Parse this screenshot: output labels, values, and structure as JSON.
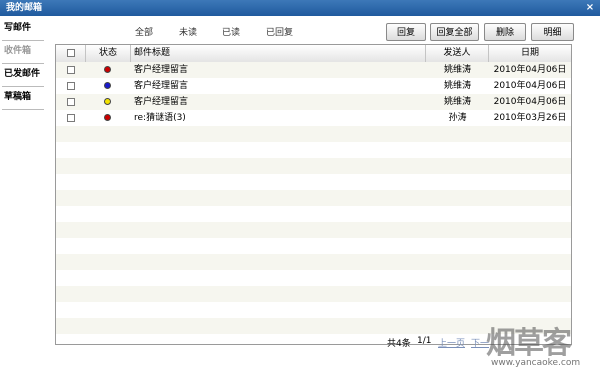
{
  "window": {
    "title": "我的邮箱",
    "close_glyph": "×"
  },
  "sidebar": {
    "items": [
      {
        "label": "写邮件",
        "active": true
      },
      {
        "label": "收件箱",
        "active": false
      },
      {
        "label": "已发邮件",
        "active": true
      },
      {
        "label": "草稿箱",
        "active": true
      }
    ]
  },
  "filters": [
    {
      "label": "全部"
    },
    {
      "label": "未读"
    },
    {
      "label": "已读"
    },
    {
      "label": "已回复"
    }
  ],
  "toolbar": {
    "reply": "回复",
    "reply_all": "回复全部",
    "delete": "删除",
    "detail": "明细"
  },
  "table": {
    "columns": [
      "",
      "状态",
      "邮件标题",
      "发送人",
      "日期"
    ],
    "rows": [
      {
        "status_color": "#cc0000",
        "subject": "客户经理留言",
        "sender": "姚维涛",
        "date": "2010年04月06日"
      },
      {
        "status_color": "#1a1acc",
        "subject": "客户经理留言",
        "sender": "姚维涛",
        "date": "2010年04月06日"
      },
      {
        "status_color": "#f2e200",
        "subject": "客户经理留言",
        "sender": "姚维涛",
        "date": "2010年04月06日"
      },
      {
        "status_color": "#cc0000",
        "subject": "re:猜谜语(3)",
        "sender": "孙涛",
        "date": "2010年03月26日"
      }
    ]
  },
  "pager": {
    "total": "共4条",
    "page": "1/1",
    "prev": "上一页",
    "next": "下一"
  },
  "watermark": {
    "brand": "烟草客",
    "url": "www.yancaoke.com"
  }
}
